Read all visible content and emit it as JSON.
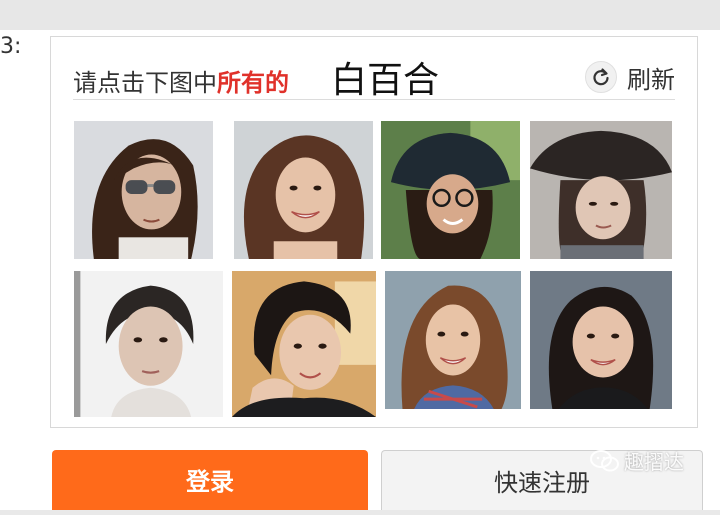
{
  "field_label": "3:",
  "captcha": {
    "prompt_plain": "请点击下图中",
    "prompt_highlight": "所有的",
    "target_word": "白百合",
    "refresh_label": "刷新",
    "refresh_icon": "refresh-icon",
    "tiles": [
      {
        "name": "photo-1",
        "desc": "woman-with-sunglasses"
      },
      {
        "name": "photo-2",
        "desc": "smiling-woman-curly-hair"
      },
      {
        "name": "photo-3",
        "desc": "woman-with-hat-and-glasses"
      },
      {
        "name": "photo-4",
        "desc": "woman-with-wide-hat"
      },
      {
        "name": "photo-5",
        "desc": "woman-hair-tied-back"
      },
      {
        "name": "photo-6",
        "desc": "woman-short-hair-hand-on-chin"
      },
      {
        "name": "photo-7",
        "desc": "smiling-woman-long-hair"
      },
      {
        "name": "photo-8",
        "desc": "woman-shoulder-length-hair"
      }
    ]
  },
  "buttons": {
    "login": "登录",
    "register": "快速注册"
  },
  "watermark": "趣摺达",
  "colors": {
    "accent_red": "#e0312a",
    "login_orange": "#ff6a1a"
  }
}
